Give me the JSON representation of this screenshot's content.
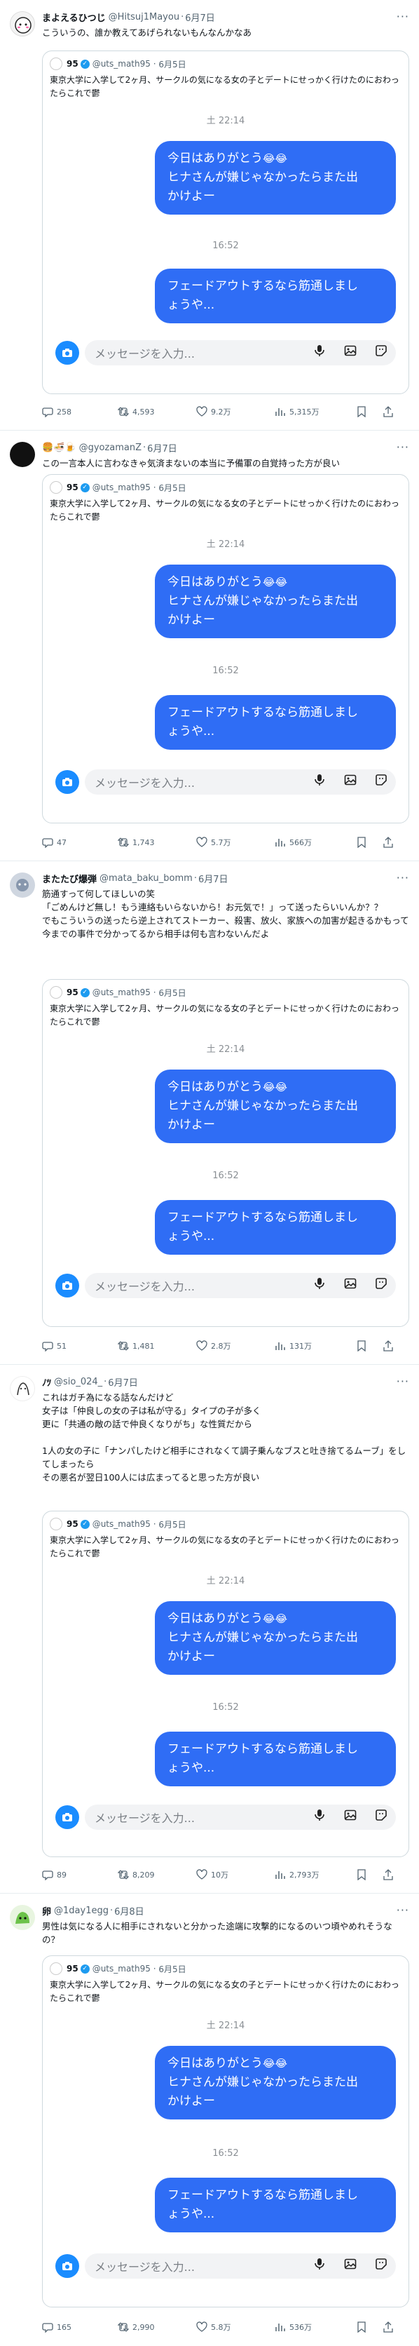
{
  "quoted": {
    "name": "95",
    "handle": "@uts_math95",
    "date": "6月5日",
    "text": "東京大学に入学して2ヶ月、サークルの気になる女の子とデートにせっかく行けたのにおわったらこれで鬱",
    "time1": "土 22:14",
    "bubble1_line1": "今日はありがとう",
    "bubble1_line2": "ヒナさんが嫌じゃなかったらまた出",
    "bubble1_line3": "かけよー",
    "time2": "16:52",
    "bubble2_line1": "フェードアウトするなら筋通しまし",
    "bubble2_line2": "ょうや...",
    "input_placeholder": "メッセージを入力...",
    "emoji": "😂😂"
  },
  "tweets": [
    {
      "name": "まよえるひつじ",
      "handle": "@Hitsuj1Mayou",
      "date": "6月7日",
      "text": "こういうの、誰か教えてあげられないもんなんかなあ",
      "replies": "258",
      "retweets": "4,593",
      "likes": "9.2万",
      "views": "5,315万"
    },
    {
      "name": "🍔🍜🍺",
      "handle": "@gyozamanZ",
      "date": "6月7日",
      "text": "この一言本人に言わなきゃ気済まないの本当に予備軍の自覚持った方が良い",
      "replies": "47",
      "retweets": "1,743",
      "likes": "5.7万",
      "views": "566万"
    },
    {
      "name": "またたび爆弾",
      "handle": "@mata_baku_bomm",
      "date": "6月7日",
      "text": "筋通すって何してほしいの笑\n「ごめんけど無し！もう連絡もいらないから！お元気で！」って送ったらいいんか？？\nでもこういうの送ったら逆上されてストーカー、殺害、放火、家族への加害が起きるかもって今までの事件で分かってるから相手は何も言わないんだよ",
      "replies": "51",
      "retweets": "1,481",
      "likes": "2.8万",
      "views": "131万"
    },
    {
      "name": "ﾉﾂ",
      "handle": "@sio_024_",
      "date": "6月7日",
      "text": "これはガチ為になる話なんだけど\n女子は「仲良しの女の子は私が守る」タイプの子が多く\n更に「共通の敵の話で仲良くなりがち」な性質だから\n\n1人の女の子に「ナンパしたけど相手にされなくて調子乗んなブスと吐き捨てるムーブ」をしてしまったら\nその悪名が翌日100人には広まってると思った方が良い",
      "replies": "89",
      "retweets": "8,209",
      "likes": "10万",
      "views": "2,793万"
    },
    {
      "name": "卵",
      "handle": "@1day1egg",
      "date": "6月8日",
      "text": "男性は気になる人に相手にされないと分かった途端に攻撃的になるのいつ頃やめれそうなの？",
      "replies": "165",
      "retweets": "2,990",
      "likes": "5.8万",
      "views": "536万"
    }
  ],
  "colors": {
    "accent": "#1d9bf0",
    "bubble": "#2f6df5"
  }
}
